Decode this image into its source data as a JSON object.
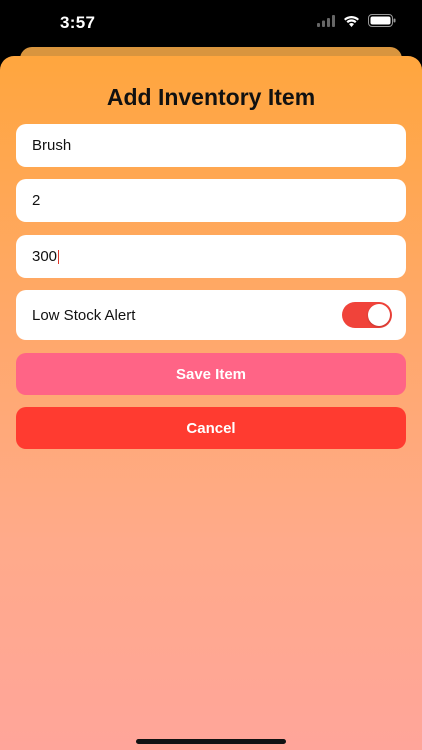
{
  "status_bar": {
    "time": "3:57"
  },
  "sheet": {
    "title": "Add Inventory Item",
    "fields": [
      {
        "value": "Brush"
      },
      {
        "value": "2"
      },
      {
        "value": "300"
      }
    ],
    "low_stock": {
      "label": "Low Stock Alert",
      "enabled": true,
      "color": "#ff3b30"
    },
    "save_label": "Save Item",
    "save_color": "#ff6486",
    "cancel_label": "Cancel",
    "cancel_color": "#ff3b30"
  },
  "icons": [
    "signal-icon",
    "wifi-icon",
    "battery-icon"
  ]
}
